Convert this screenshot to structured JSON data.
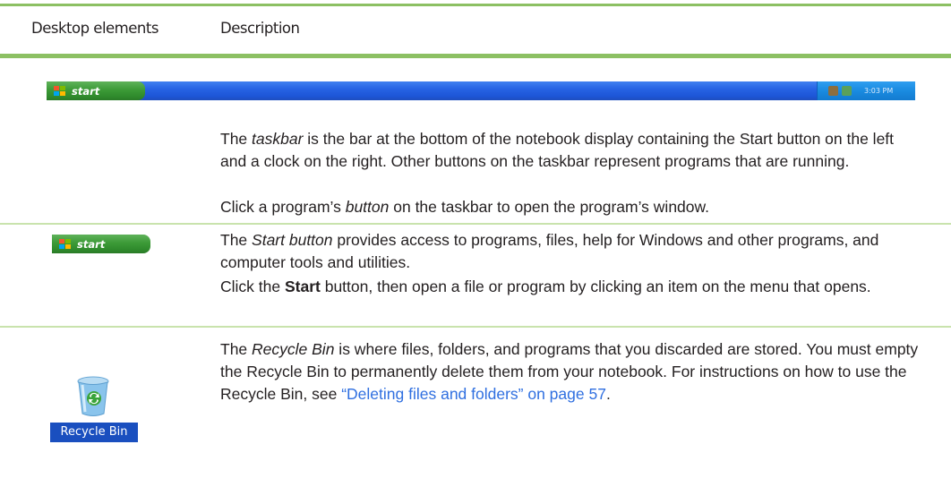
{
  "table": {
    "header": {
      "col1": "Desktop elements",
      "col2": "Description"
    },
    "taskbar": {
      "start_label": "start",
      "clock": "3:03 PM",
      "p1_before": "The ",
      "p1_term": "taskbar",
      "p1_after": " is the bar at the bottom of the notebook display containing the Start button on the left and a clock on the right. Other buttons on the taskbar represent programs that are running.",
      "p2_before": "Click a program’s ",
      "p2_term": "button",
      "p2_after": " on the taskbar to open the program’s window."
    },
    "start_button": {
      "start_label": "start",
      "p1_before": "The ",
      "p1_term": "Start button",
      "p1_after": " provides access to programs, files, help for Windows and other programs, and computer tools and utilities.",
      "p2_before": "Click the ",
      "p2_bold": "Start",
      "p2_after": " button, then open a file or program by clicking an item on the menu that opens."
    },
    "recycle_bin": {
      "icon_label": "Recycle Bin",
      "p1_before": "The ",
      "p1_term": "Recycle Bin",
      "p1_middle": " is where files, folders, and programs that you discarded are stored. You must empty the Recycle Bin to permanently delete them from your notebook. For instructions on how to use the Recycle Bin, see ",
      "p1_link": "“Deleting files and folders” on page 57",
      "p1_end": "."
    }
  },
  "colors": {
    "rule_green": "#8cc063",
    "row_rule": "#c9e3ad",
    "link": "#2f6fe0"
  }
}
